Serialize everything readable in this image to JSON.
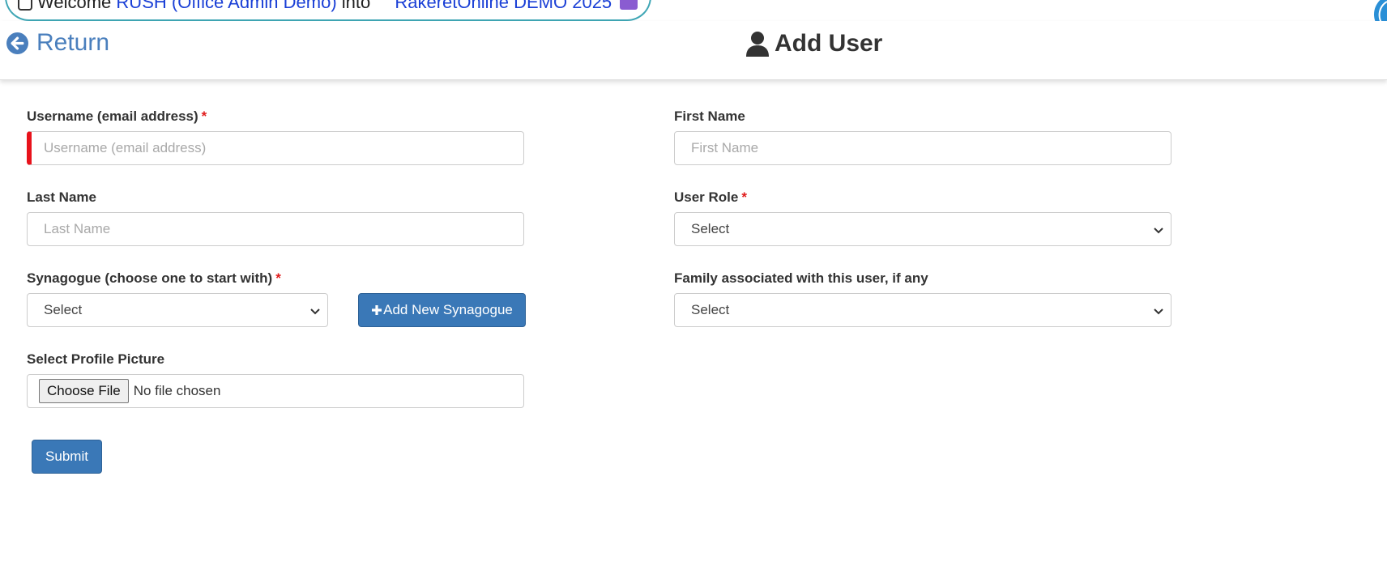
{
  "banner": {
    "welcome": "Welcome",
    "user": "RUSH (Office Admin Demo)",
    "into": "into",
    "site": "RakeretOnline DEMO 2025"
  },
  "header": {
    "return_label": "Return",
    "title": "Add User",
    "icons": {
      "return": "arrow-left-circle-icon",
      "title": "user-icon"
    }
  },
  "form": {
    "username": {
      "label": "Username (email address)",
      "required": "*",
      "placeholder": "Username (email address)",
      "value": ""
    },
    "first_name": {
      "label": "First Name",
      "placeholder": "First Name",
      "value": ""
    },
    "last_name": {
      "label": "Last Name",
      "placeholder": "Last Name",
      "value": ""
    },
    "user_role": {
      "label": "User Role",
      "required": "*",
      "selected": "Select"
    },
    "synagogue": {
      "label": "Synagogue (choose one to start with)",
      "required": "*",
      "selected": "Select"
    },
    "add_synagogue_button": "Add New Synagogue",
    "family": {
      "label": "Family associated with this user, if any",
      "selected": "Select"
    },
    "profile_picture": {
      "label": "Select Profile Picture",
      "button": "Choose File",
      "status": "No file chosen"
    },
    "submit_button": "Submit"
  },
  "colors": {
    "accent": "#3a78b7",
    "link": "#4a7fbd",
    "required": "#e01b1b"
  }
}
